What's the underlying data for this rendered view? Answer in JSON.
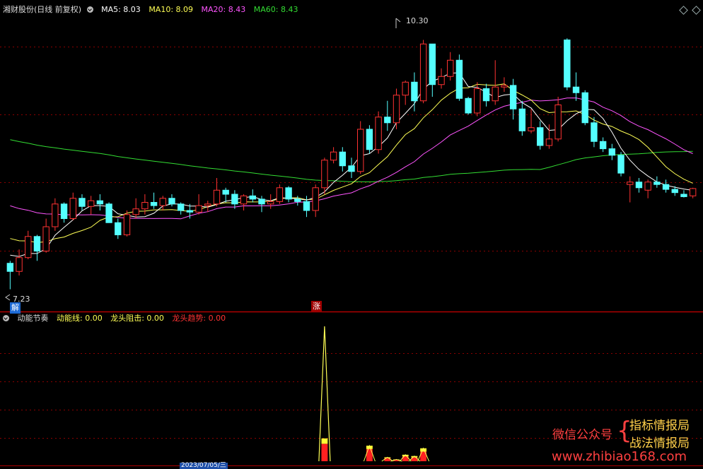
{
  "main_panel": {
    "title": "湘财股份(日线 前复权)",
    "ma_labels": [
      {
        "text": "MA5: 8.03",
        "color": "#ffffff"
      },
      {
        "text": "MA10: 8.09",
        "color": "#ffff55"
      },
      {
        "text": "MA20: 8.43",
        "color": "#ff55ff"
      },
      {
        "text": "MA60: 8.43",
        "color": "#33dd33"
      }
    ],
    "high_label": "10.30",
    "low_label": "7.23",
    "tag_jie": "解",
    "tag_zhang": "涨"
  },
  "sub_panel": {
    "title": "动能节奏",
    "labels": [
      {
        "text": "动能线: 0.00",
        "color": "#ffff55"
      },
      {
        "text": "龙头阻击: 0.00",
        "color": "#ffff55"
      },
      {
        "text": "龙头趋势: 0.00",
        "color": "#ff3333"
      }
    ]
  },
  "watermark": {
    "left": "微信公众号",
    "right_top": "指标情报局",
    "right_bottom": "战法情报局",
    "url": "www.zhibiao168.com"
  },
  "footer": {
    "date_label": "2023/07/05/三"
  },
  "colors": {
    "up": "#ff3232",
    "down": "#54ffff",
    "ma5": "#ffffff",
    "ma10": "#ffff55",
    "ma20": "#ff55ff",
    "ma60": "#33dd33",
    "grid": "#8b0000"
  },
  "chart_data": {
    "type": "candlestick",
    "ylim": [
      7.0,
      10.6
    ],
    "candles": [
      [
        7.55,
        7.58,
        7.23,
        7.45
      ],
      [
        7.45,
        7.72,
        7.4,
        7.62
      ],
      [
        7.62,
        7.95,
        7.6,
        7.88
      ],
      [
        7.88,
        7.9,
        7.58,
        7.7
      ],
      [
        7.7,
        8.1,
        7.68,
        8.0
      ],
      [
        8.0,
        8.35,
        7.95,
        8.28
      ],
      [
        8.28,
        8.3,
        8.05,
        8.1
      ],
      [
        8.1,
        8.42,
        8.08,
        8.35
      ],
      [
        8.35,
        8.4,
        8.2,
        8.25
      ],
      [
        8.25,
        8.38,
        8.15,
        8.32
      ],
      [
        8.32,
        8.4,
        8.2,
        8.28
      ],
      [
        8.28,
        8.3,
        8.08,
        8.05
      ],
      [
        8.05,
        8.1,
        7.85,
        7.9
      ],
      [
        7.9,
        8.2,
        7.88,
        8.15
      ],
      [
        8.15,
        8.35,
        8.1,
        8.22
      ],
      [
        8.22,
        8.4,
        8.15,
        8.3
      ],
      [
        8.3,
        8.42,
        8.22,
        8.26
      ],
      [
        8.26,
        8.38,
        8.2,
        8.35
      ],
      [
        8.35,
        8.4,
        8.25,
        8.28
      ],
      [
        8.28,
        8.3,
        8.15,
        8.2
      ],
      [
        8.2,
        8.28,
        8.1,
        8.18
      ],
      [
        8.18,
        8.4,
        8.15,
        8.26
      ],
      [
        8.26,
        8.32,
        8.18,
        8.28
      ],
      [
        8.28,
        8.6,
        8.25,
        8.45
      ],
      [
        8.45,
        8.48,
        8.3,
        8.4
      ],
      [
        8.4,
        8.45,
        8.22,
        8.28
      ],
      [
        8.28,
        8.4,
        8.2,
        8.38
      ],
      [
        8.38,
        8.46,
        8.3,
        8.34
      ],
      [
        8.34,
        8.38,
        8.18,
        8.28
      ],
      [
        8.28,
        8.4,
        8.22,
        8.31
      ],
      [
        8.31,
        8.52,
        8.28,
        8.48
      ],
      [
        8.48,
        8.5,
        8.3,
        8.34
      ],
      [
        8.34,
        8.38,
        8.26,
        8.31
      ],
      [
        8.31,
        8.38,
        8.12,
        8.2
      ],
      [
        8.2,
        8.52,
        8.12,
        8.48
      ],
      [
        8.48,
        8.85,
        8.4,
        8.82
      ],
      [
        8.82,
        8.98,
        8.78,
        8.92
      ],
      [
        8.92,
        8.98,
        8.68,
        8.75
      ],
      [
        8.75,
        8.85,
        8.6,
        8.68
      ],
      [
        8.68,
        9.3,
        8.65,
        9.2
      ],
      [
        9.2,
        9.25,
        8.9,
        8.95
      ],
      [
        8.95,
        9.42,
        8.9,
        9.35
      ],
      [
        9.35,
        9.55,
        9.18,
        9.28
      ],
      [
        9.28,
        9.7,
        9.2,
        9.62
      ],
      [
        9.62,
        9.8,
        9.5,
        9.78
      ],
      [
        9.78,
        9.9,
        9.42,
        9.55
      ],
      [
        9.55,
        10.3,
        9.52,
        10.25
      ],
      [
        10.25,
        10.25,
        9.6,
        9.75
      ],
      [
        9.75,
        9.95,
        9.7,
        9.85
      ],
      [
        9.85,
        10.15,
        9.8,
        10.05
      ],
      [
        10.05,
        10.12,
        9.55,
        9.58
      ],
      [
        9.58,
        9.6,
        9.38,
        9.4
      ],
      [
        9.4,
        9.78,
        9.36,
        9.7
      ],
      [
        9.7,
        9.76,
        9.48,
        9.55
      ],
      [
        9.55,
        10.05,
        9.5,
        9.72
      ],
      [
        9.72,
        9.84,
        9.66,
        9.74
      ],
      [
        9.74,
        9.82,
        9.32,
        9.45
      ],
      [
        9.45,
        9.55,
        9.12,
        9.18
      ],
      [
        9.18,
        9.45,
        9.15,
        9.22
      ],
      [
        9.22,
        9.3,
        8.95,
        9.0
      ],
      [
        9.0,
        9.26,
        8.96,
        9.08
      ],
      [
        9.08,
        9.6,
        9.05,
        9.5
      ],
      [
        10.3,
        10.32,
        9.68,
        9.72
      ],
      [
        9.72,
        9.9,
        9.55,
        9.65
      ],
      [
        9.65,
        9.68,
        9.25,
        9.28
      ],
      [
        9.28,
        9.35,
        8.98,
        9.05
      ],
      [
        9.05,
        9.1,
        8.92,
        8.96
      ],
      [
        8.96,
        9.02,
        8.82,
        8.88
      ],
      [
        8.88,
        8.92,
        8.62,
        8.66
      ],
      [
        8.52,
        8.62,
        8.3,
        8.55
      ],
      [
        8.55,
        8.6,
        8.42,
        8.48
      ],
      [
        8.45,
        8.58,
        8.35,
        8.55
      ],
      [
        8.55,
        8.62,
        8.48,
        8.52
      ],
      [
        8.52,
        8.58,
        8.42,
        8.46
      ],
      [
        8.46,
        8.5,
        8.38,
        8.42
      ],
      [
        8.4,
        8.45,
        8.36,
        8.37
      ],
      [
        8.38,
        8.48,
        8.35,
        8.47
      ]
    ],
    "volume_bars": [
      {
        "i": 35,
        "red": 1.0,
        "yellow": 0.4
      },
      {
        "i": 40,
        "red": 0.7,
        "yellow": 0.25
      },
      {
        "i": 42,
        "red": 0.18,
        "yellow": 0.06
      },
      {
        "i": 43,
        "red": 0.08,
        "yellow": 0.03
      },
      {
        "i": 44,
        "red": 0.28,
        "yellow": 0.12
      },
      {
        "i": 45,
        "red": 0.22,
        "yellow": 0.1
      },
      {
        "i": 46,
        "red": 0.55,
        "yellow": 0.25
      }
    ]
  }
}
